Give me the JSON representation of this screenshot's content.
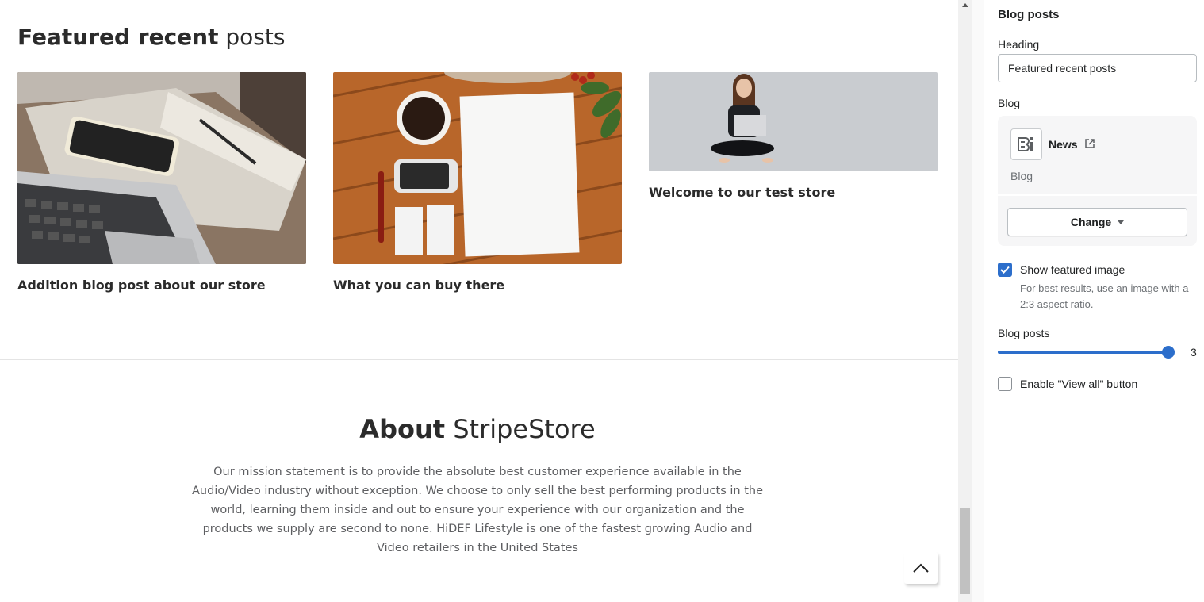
{
  "preview": {
    "section_title_bold": "Featured recent",
    "section_title_light": "posts",
    "posts": [
      {
        "title": "Addition blog post about our store",
        "image": "notebook-phone-laptop-photo"
      },
      {
        "title": "What you can buy there",
        "image": "coffee-stationery-flatlay-photo"
      },
      {
        "title": "Welcome to our test store",
        "image": "woman-with-laptop-photo"
      }
    ],
    "about_title_bold": "About",
    "about_title_light": "StripeStore",
    "about_text": "Our mission statement is to provide the absolute best customer experience available in the Audio/Video industry without exception. We choose to only sell the best performing products in the world, learning them inside and out to ensure your experience with our organization and the products we supply are second to none. HiDEF Lifestyle is one of the fastest growing Audio and Video retailers in the United States",
    "back_to_top_icon": "chevron-up-icon"
  },
  "panel": {
    "title": "Blog posts",
    "heading_label": "Heading",
    "heading_value": "Featured recent posts",
    "blog_label": "Blog",
    "blog": {
      "name": "News",
      "subtitle": "Blog",
      "icon": "blog-icon",
      "link_icon": "external-link-icon"
    },
    "change_label": "Change",
    "show_featured_image": {
      "label": "Show featured image",
      "checked": true,
      "help": "For best results, use an image with a 2:3 aspect ratio."
    },
    "blog_posts_label": "Blog posts",
    "blog_posts_value": "3",
    "blog_posts_fraction": 1.0,
    "view_all": {
      "label": "Enable \"View all\" button",
      "checked": false
    }
  },
  "colors": {
    "accent": "#2c6ecb",
    "text": "#202223",
    "muted": "#6d7175"
  }
}
